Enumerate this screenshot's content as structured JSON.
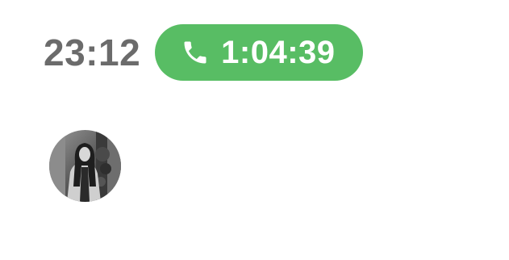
{
  "status_bar": {
    "time": "23:12",
    "call": {
      "icon": "phone-icon",
      "duration": "1:04:39",
      "pill_color": "#58bd64",
      "text_color": "#ffffff"
    },
    "time_color": "#6b6b6b"
  },
  "avatar": {
    "icon": "avatar",
    "style": "grayscale-photo"
  }
}
